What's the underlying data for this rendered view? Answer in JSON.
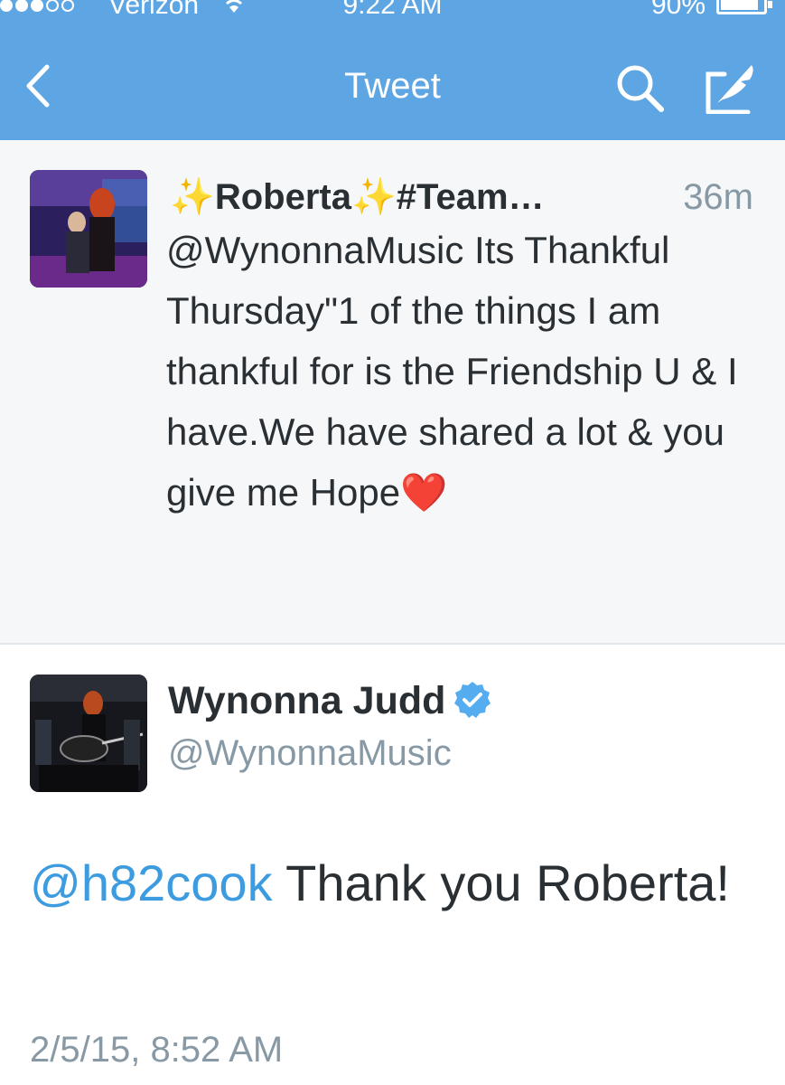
{
  "status_bar": {
    "carrier": "Verizon",
    "time": "9:22 AM",
    "battery": "90%",
    "battery_level": 0.9,
    "signal_bars_on": 3,
    "signal_bars_total": 5
  },
  "nav": {
    "title": "Tweet",
    "back_icon": "chevron-left-icon",
    "search_icon": "search-icon",
    "compose_icon": "compose-icon"
  },
  "parent_tweet": {
    "sparkle1": "✨",
    "name": "Roberta",
    "sparkle2": "✨",
    "name_rest": "#Team…",
    "time": "36m",
    "text": "@WynonnaMusic Its Thankful Thursday\"1 of the things I am thankful for is the Friendship U & I have.We have shared a lot & you give me Hope",
    "emoji": "❤️"
  },
  "main_tweet": {
    "name": "Wynonna Judd",
    "handle": "@WynonnaMusic",
    "mention": "@h82cook",
    "text": " Thank you Roberta!",
    "date": "2/5/15, 8:52 AM"
  },
  "colors": {
    "nav_bar": "#5ea5e3",
    "link": "#3d9be0",
    "secondary_text": "#8899a6",
    "verified": "#55acee"
  }
}
